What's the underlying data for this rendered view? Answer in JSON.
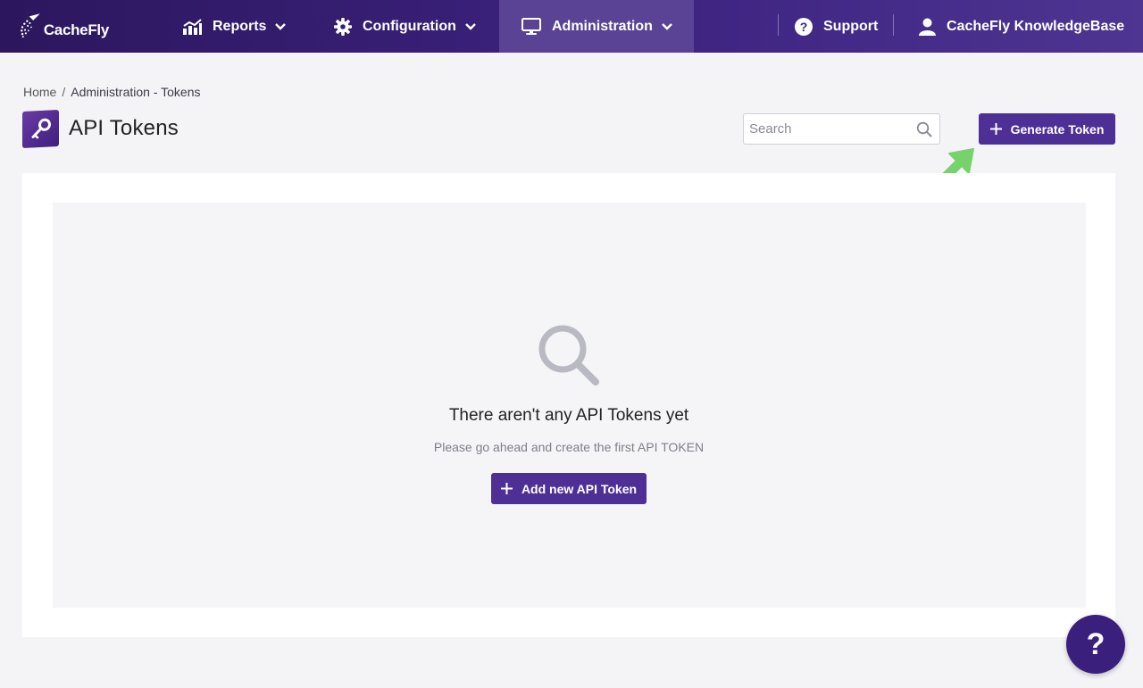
{
  "nav": {
    "logo_text": "CacheFly",
    "reports_label": "Reports",
    "configuration_label": "Configuration",
    "administration_label": "Administration",
    "support_label": "Support",
    "user_label": "CacheFly KnowledgeBase"
  },
  "breadcrumb": {
    "home": "Home",
    "separator": "/",
    "current": "Administration - Tokens"
  },
  "page": {
    "title": "API Tokens"
  },
  "search": {
    "placeholder": "Search",
    "value": ""
  },
  "toolbar": {
    "generate_label": "Generate Token"
  },
  "empty_state": {
    "title": "There aren't any API Tokens yet",
    "subtitle": "Please go ahead and create the first API TOKEN",
    "button_label": "Add new API Token"
  },
  "help": {
    "label": "?"
  },
  "colors": {
    "nav_bg": "#3d2280",
    "nav_active": "#5a4394",
    "primary_button": "#4e2f96",
    "annotation_arrow": "#77d26b",
    "help_fab": "#3a1f7d"
  }
}
